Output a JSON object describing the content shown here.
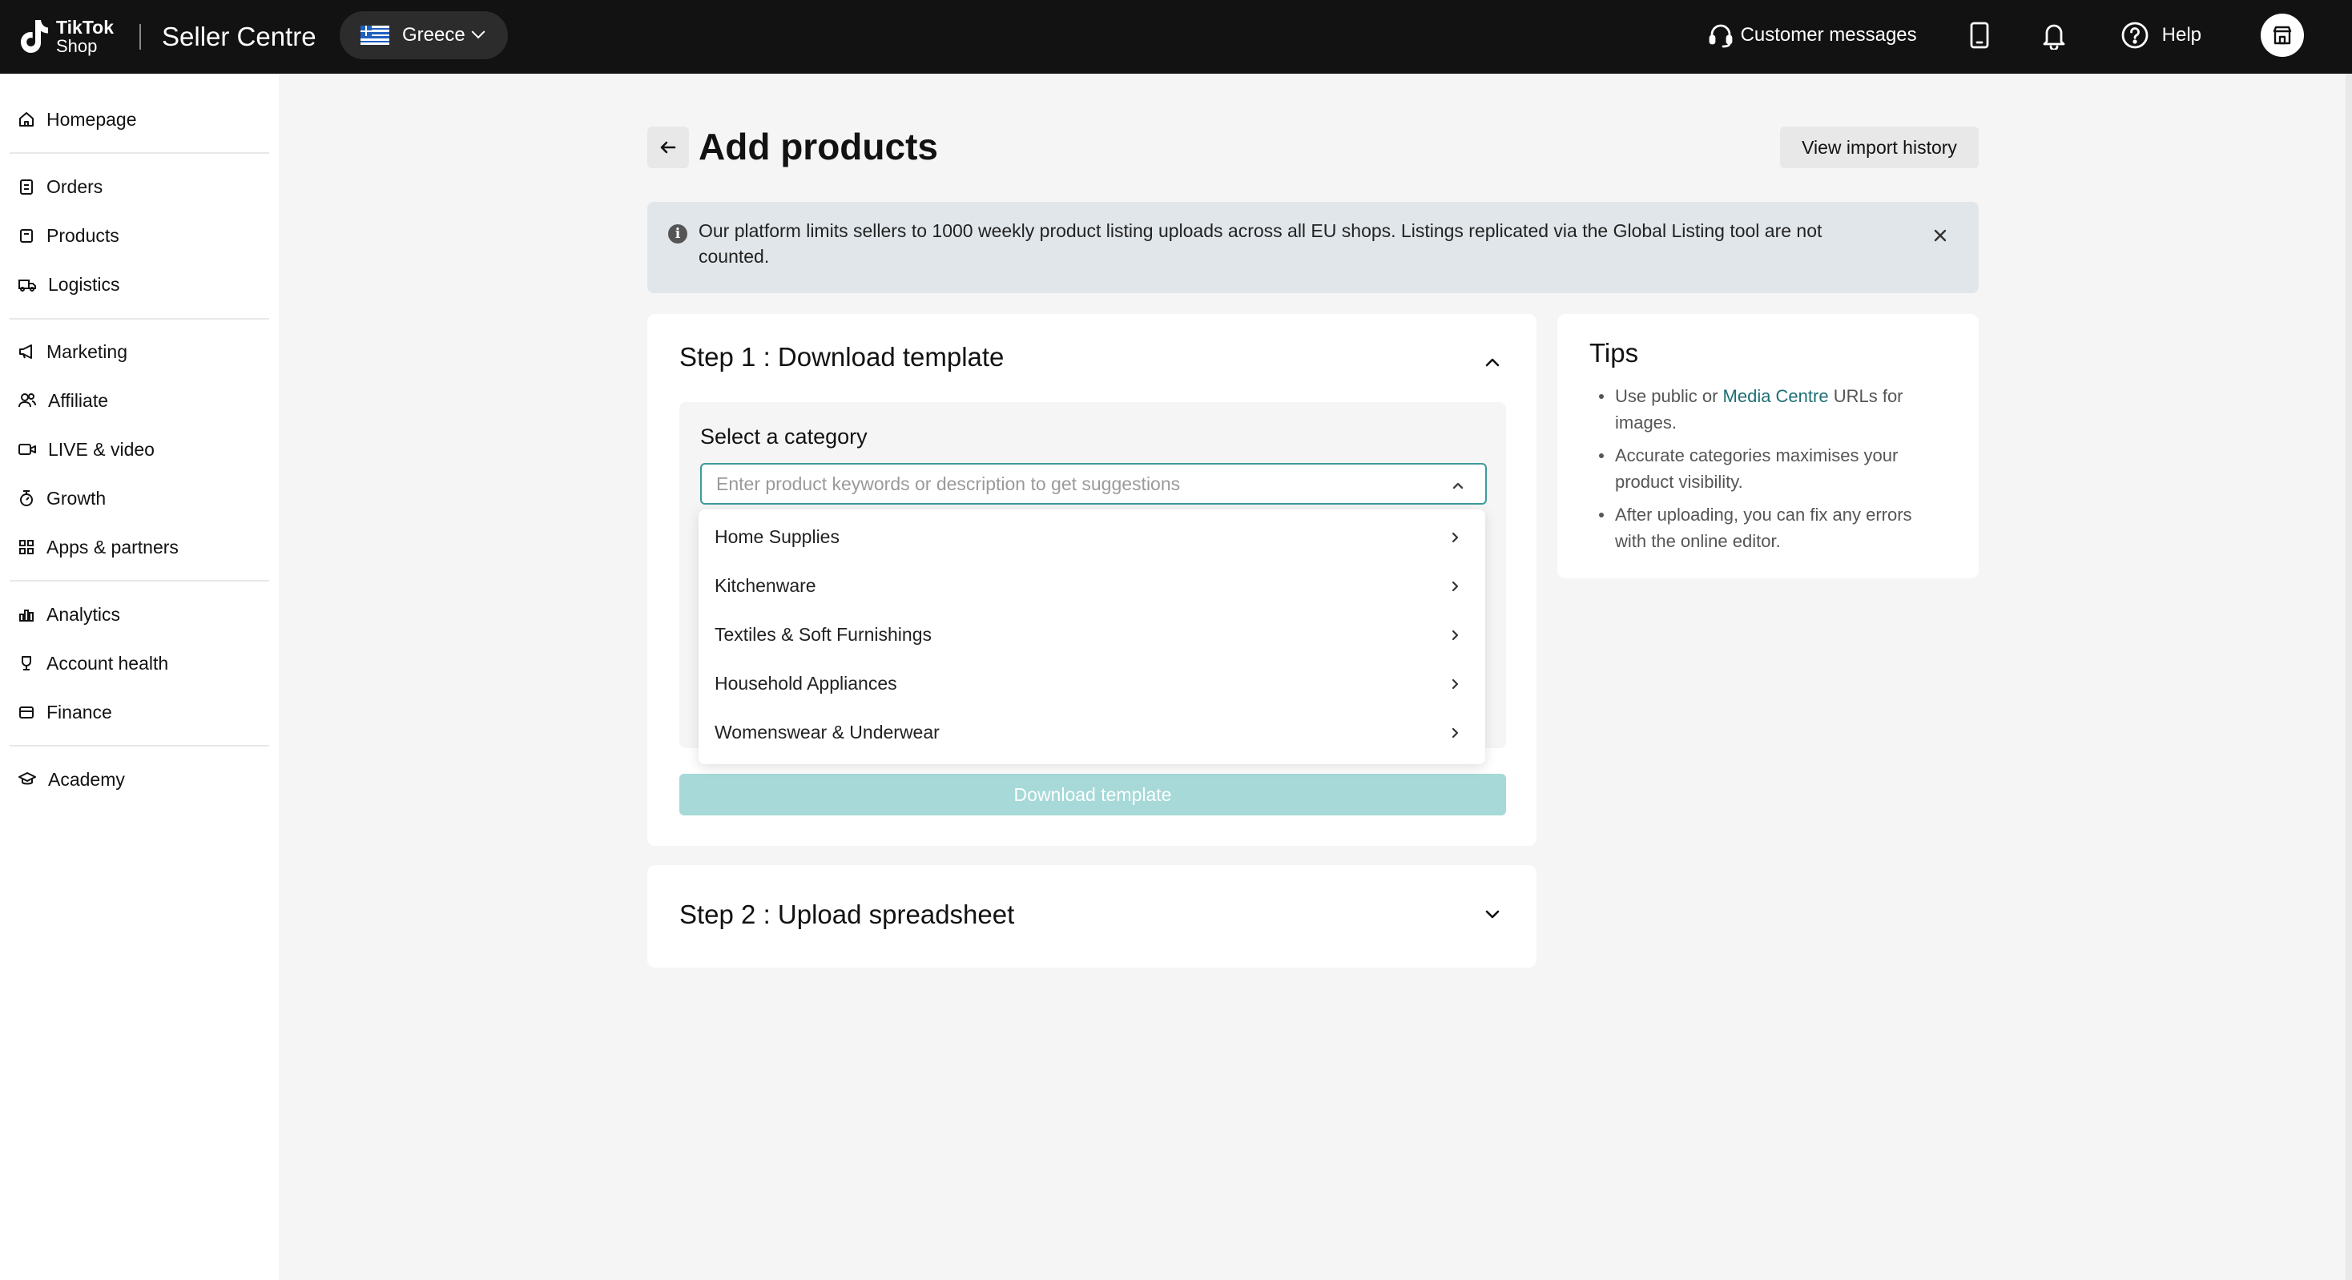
{
  "header": {
    "logo_line1": "TikTok",
    "logo_line2": "Shop",
    "app_title": "Seller Centre",
    "region": "Greece",
    "customer_messages": "Customer messages",
    "help": "Help"
  },
  "sidebar": {
    "items": [
      {
        "label": "Homepage",
        "icon": "home-icon"
      },
      {
        "label": "Orders",
        "icon": "orders-icon"
      },
      {
        "label": "Products",
        "icon": "products-icon"
      },
      {
        "label": "Logistics",
        "icon": "truck-icon"
      },
      {
        "label": "Marketing",
        "icon": "megaphone-icon"
      },
      {
        "label": "Affiliate",
        "icon": "people-icon"
      },
      {
        "label": "LIVE & video",
        "icon": "video-icon"
      },
      {
        "label": "Growth",
        "icon": "growth-icon"
      },
      {
        "label": "Apps & partners",
        "icon": "apps-icon"
      },
      {
        "label": "Analytics",
        "icon": "analytics-icon"
      },
      {
        "label": "Account health",
        "icon": "trophy-icon"
      },
      {
        "label": "Finance",
        "icon": "wallet-icon"
      },
      {
        "label": "Academy",
        "icon": "graduation-cap-icon"
      }
    ]
  },
  "page": {
    "title": "Add products",
    "view_import_history": "View import history",
    "banner_text": "Our platform limits sellers to 1000 weekly product listing uploads across all EU shops. Listings replicated via the Global Listing tool are not counted."
  },
  "step1": {
    "title": "Step 1 : Download template",
    "select_label": "Select a category",
    "search_placeholder": "Enter product keywords or description to get suggestions",
    "categories": [
      "Home Supplies",
      "Kitchenware",
      "Textiles & Soft Furnishings",
      "Household Appliances",
      "Womenswear & Underwear"
    ],
    "download_button": "Download template"
  },
  "step2": {
    "title": "Step 2 : Upload spreadsheet"
  },
  "tips": {
    "title": "Tips",
    "tip1_pre": "Use public or ",
    "tip1_link": "Media Centre",
    "tip1_post": " URLs for images.",
    "tip2": "Accurate categories maximises your product visibility.",
    "tip3": "After uploading, you can fix any errors with the online editor."
  },
  "colors": {
    "topbar": "#121212",
    "accent": "#3d9a9b",
    "link": "#1e6f74",
    "disabled_button": "#a6d9d8"
  }
}
